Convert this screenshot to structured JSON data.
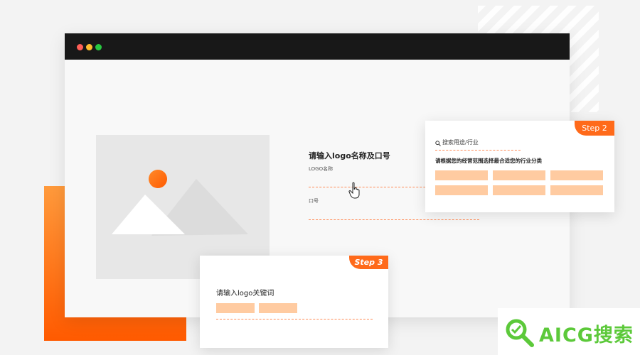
{
  "window": {
    "traffic_lights": [
      "close-dot",
      "minimize-dot",
      "maximize-dot"
    ]
  },
  "form": {
    "title": "请输入logo名称及口号",
    "logo_label": "LOGO名称",
    "slogan_label": "口号"
  },
  "step2": {
    "badge": "Step 2",
    "search_placeholder": "搜索用途/行业",
    "prompt": "请根据您的经营范围选择最合适您的行业分类",
    "chip_count_shown": 6
  },
  "step3": {
    "badge": "Step 3",
    "title": "请输入logo关键词",
    "chip_count_shown": 2
  },
  "watermark": {
    "text": "AICG搜索"
  },
  "colors": {
    "accent": "#ff6a1a",
    "chip": "#ffcba1",
    "titlebar": "#181818",
    "watermark_green": "#5cc93a"
  }
}
